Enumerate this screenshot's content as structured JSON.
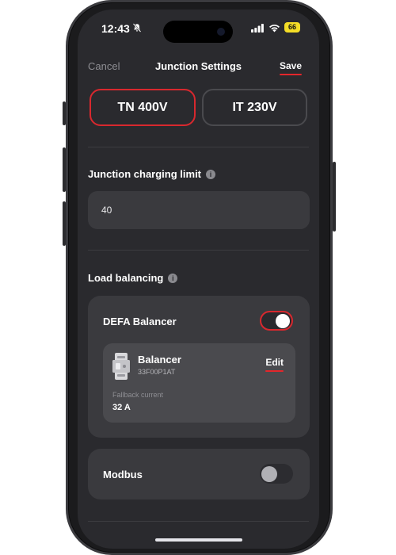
{
  "status_bar": {
    "time": "12:43",
    "battery": "66"
  },
  "nav": {
    "cancel_label": "Cancel",
    "title": "Junction Settings",
    "save_label": "Save"
  },
  "network_type": {
    "options": [
      "TN 400V",
      "IT 230V"
    ],
    "selected": "TN 400V"
  },
  "charging_limit": {
    "label": "Junction charging limit",
    "value": "40"
  },
  "load_balancing": {
    "label": "Load balancing",
    "defa_balancer": {
      "label": "DEFA Balancer",
      "enabled": true,
      "device": {
        "name": "Balancer",
        "id": "33F00P1AT",
        "edit_label": "Edit",
        "fallback_label": "Fallback current",
        "fallback_value": "32 A"
      }
    },
    "modbus": {
      "label": "Modbus",
      "enabled": false
    }
  },
  "colors": {
    "accent": "#d8282e",
    "background": "#2a2a2e",
    "card": "#3a3a3e"
  }
}
